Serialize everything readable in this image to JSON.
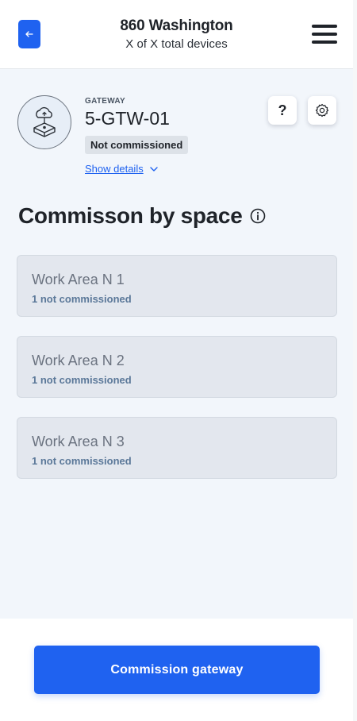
{
  "header": {
    "title": "860 Washington",
    "subtitle": "X of X total devices",
    "back_icon": "arrow-left-icon",
    "menu_icon": "hamburger-menu-icon"
  },
  "gateway": {
    "type_label": "GATEWAY",
    "name": "5-GTW-01",
    "status_badge": "Not commissioned",
    "show_details": "Show details",
    "help_label": "?"
  },
  "section": {
    "title": "Commisson by space"
  },
  "spaces": [
    {
      "name": "Work Area N 1",
      "status": "1 not commissioned"
    },
    {
      "name": "Work Area N 2",
      "status": "1 not commissioned"
    },
    {
      "name": "Work Area N 3",
      "status": "1 not commissioned"
    }
  ],
  "footer": {
    "primary_button": "Commission gateway"
  },
  "colors": {
    "accent": "#1f62f0",
    "background": "#f2f6fb",
    "card": "#e3e7ee"
  }
}
